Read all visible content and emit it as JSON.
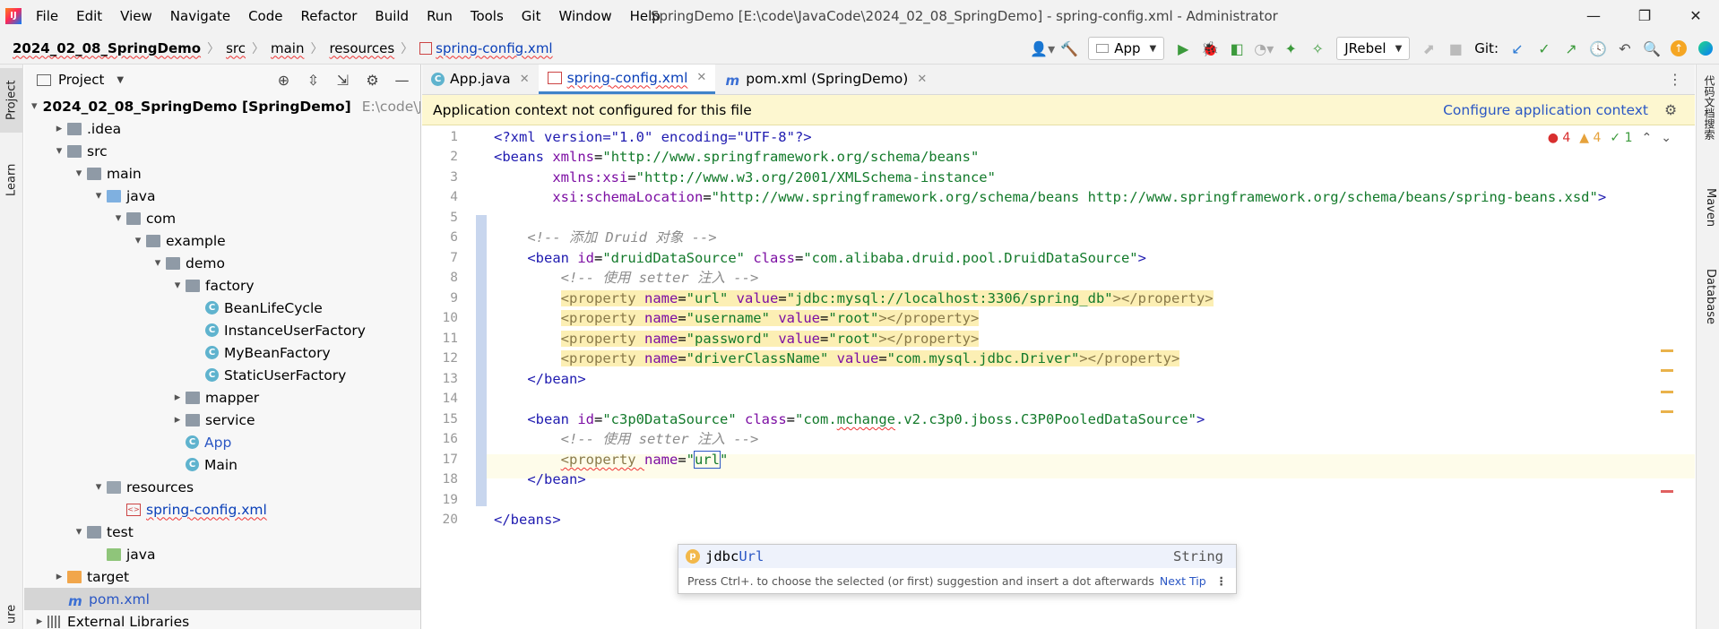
{
  "menubar": {
    "items": [
      "File",
      "Edit",
      "View",
      "Navigate",
      "Code",
      "Refactor",
      "Build",
      "Run",
      "Tools",
      "Git",
      "Window",
      "Help"
    ],
    "window_title": "SpringDemo [E:\\code\\JavaCode\\2024_02_08_SpringDemo] - spring-config.xml - Administrator"
  },
  "breadcrumb": [
    "2024_02_08_SpringDemo",
    "src",
    "main",
    "resources",
    "spring-config.xml"
  ],
  "toolbar": {
    "run_config": "App",
    "jrebel": "JRebel",
    "git_label": "Git:"
  },
  "left_strip": {
    "project_tab": "Project",
    "learn_tab": "Learn",
    "bottom_tab": "ure"
  },
  "project_panel": {
    "title": "Project",
    "tree": [
      {
        "label": "2024_02_08_SpringDemo [SpringDemo]",
        "extra": "E:\\code\\Java",
        "depth": 0,
        "arrow": "▾",
        "icon": "module",
        "style": "bold"
      },
      {
        "label": ".idea",
        "depth": 1,
        "arrow": "▸",
        "icon": "folder"
      },
      {
        "label": "src",
        "depth": 1,
        "arrow": "▾",
        "icon": "folder"
      },
      {
        "label": "main",
        "depth": 2,
        "arrow": "▾",
        "icon": "folder"
      },
      {
        "label": "java",
        "depth": 3,
        "arrow": "▾",
        "icon": "folder-blue"
      },
      {
        "label": "com",
        "depth": 4,
        "arrow": "▾",
        "icon": "folder"
      },
      {
        "label": "example",
        "depth": 5,
        "arrow": "▾",
        "icon": "folder"
      },
      {
        "label": "demo",
        "depth": 6,
        "arrow": "▾",
        "icon": "folder"
      },
      {
        "label": "factory",
        "depth": 7,
        "arrow": "▾",
        "icon": "folder"
      },
      {
        "label": "BeanLifeCycle",
        "depth": 8,
        "arrow": "",
        "icon": "class"
      },
      {
        "label": "InstanceUserFactory",
        "depth": 8,
        "arrow": "",
        "icon": "class"
      },
      {
        "label": "MyBeanFactory",
        "depth": 8,
        "arrow": "",
        "icon": "class"
      },
      {
        "label": "StaticUserFactory",
        "depth": 8,
        "arrow": "",
        "icon": "class"
      },
      {
        "label": "mapper",
        "depth": 7,
        "arrow": "▸",
        "icon": "folder"
      },
      {
        "label": "service",
        "depth": 7,
        "arrow": "▸",
        "icon": "folder"
      },
      {
        "label": "App",
        "depth": 7,
        "arrow": "",
        "icon": "class",
        "style": "blue"
      },
      {
        "label": "Main",
        "depth": 7,
        "arrow": "",
        "icon": "class"
      },
      {
        "label": "resources",
        "depth": 3,
        "arrow": "▾",
        "icon": "folder-res"
      },
      {
        "label": "spring-config.xml",
        "depth": 4,
        "arrow": "",
        "icon": "xml",
        "style": "xml"
      },
      {
        "label": "test",
        "depth": 2,
        "arrow": "▾",
        "icon": "folder"
      },
      {
        "label": "java",
        "depth": 3,
        "arrow": "",
        "icon": "folder-green"
      },
      {
        "label": "target",
        "depth": 1,
        "arrow": "▸",
        "icon": "folder-orange"
      },
      {
        "label": "pom.xml",
        "depth": 1,
        "arrow": "",
        "icon": "maven",
        "style": "blue",
        "selected": true
      },
      {
        "label": "External Libraries",
        "depth": 0,
        "arrow": "▸",
        "icon": "lib"
      }
    ]
  },
  "tabs": [
    {
      "label": "App.java",
      "icon": "class",
      "active": false
    },
    {
      "label": "spring-config.xml",
      "icon": "xml",
      "active": true
    },
    {
      "label": "pom.xml (SpringDemo)",
      "icon": "maven",
      "active": false
    }
  ],
  "banner": {
    "message": "Application context not configured for this file",
    "action": "Configure application context"
  },
  "inspections": {
    "errors": "4",
    "warnings": "4",
    "ok": "1"
  },
  "code": {
    "line_numbers": [
      "1",
      "2",
      "3",
      "4",
      "5",
      "6",
      "7",
      "8",
      "9",
      "10",
      "11",
      "12",
      "13",
      "14",
      "15",
      "16",
      "17",
      "18",
      "19",
      "20"
    ],
    "comment_druid": "<!-- 添加 Druid 对象 -->",
    "comment_setter": "<!-- 使用 setter 注入 -->",
    "xml_decl": "<?xml version=\"1.0\" encoding=\"UTF-8\"?>",
    "beans_open": "<beans",
    "beans_ns_attr": "xmlns",
    "beans_ns_val": "\"http://www.springframework.org/schema/beans\"",
    "xsi_attr": "xmlns:xsi",
    "xsi_val": "\"http://www.w3.org/2001/XMLSchema-instance\"",
    "schema_attr": "xsi:schemaLocation",
    "schema_val": "\"http://www.springframework.org/schema/beans http://www.springframework.org/schema/beans/spring-beans.xsd\"",
    "bean1_id": "\"druidDataSource\"",
    "bean1_class": "\"com.alibaba.druid.pool.DruidDataSource\"",
    "p_url_name": "\"url\"",
    "p_url_value": "\"jdbc:mysql://localhost:3306/spring_db\"",
    "p_user_name": "\"username\"",
    "p_user_value": "\"root\"",
    "p_pass_name": "\"password\"",
    "p_pass_value": "\"root\"",
    "p_drv_name": "\"driverClassName\"",
    "p_drv_value": "\"com.mysql.jdbc.Driver\"",
    "bean2_id": "\"c3p0DataSource\"",
    "bean2_class_pre": "\"com.",
    "bean2_class_mid": "mchange",
    "bean2_class_post": ".v2.c3p0.jboss.C3P0PooledDataSource\"",
    "typing": "url",
    "bean_close": "</bean>",
    "beans_close": "</beans>"
  },
  "completion": {
    "suggestion_prefix": "jdbc",
    "suggestion_match": "Url",
    "type": "String",
    "hint": "Press Ctrl+. to choose the selected (or first) suggestion and insert a dot afterwards",
    "next_tip": "Next Tip"
  },
  "right_strip": {
    "plugin": "代码文档搜索",
    "maven": "Maven",
    "database": "Database"
  }
}
